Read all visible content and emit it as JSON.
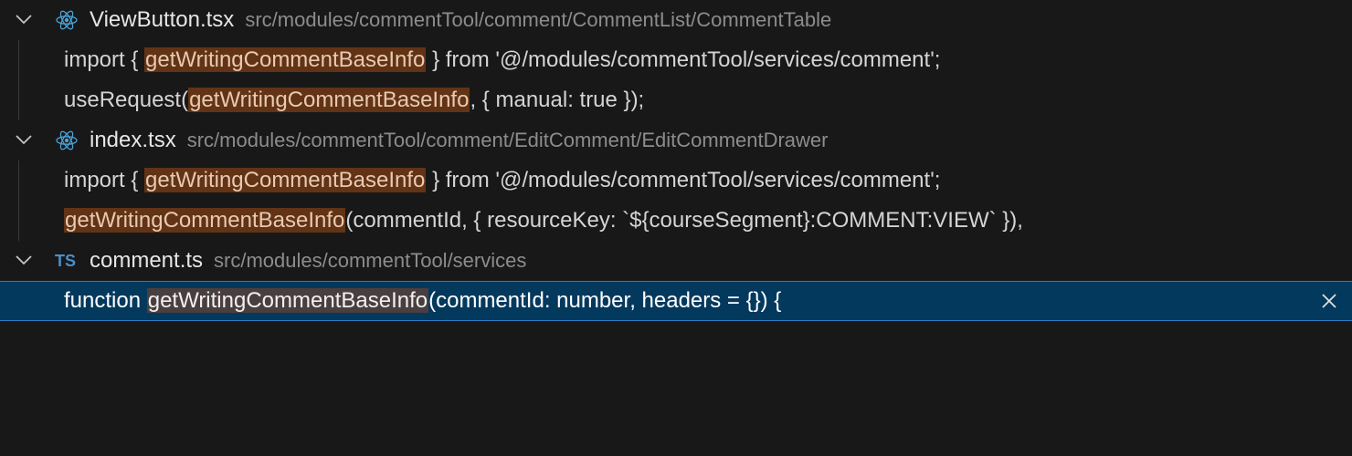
{
  "results": [
    {
      "file_name": "ViewButton.tsx",
      "path": "src/modules/commentTool/comment/CommentList/CommentTable",
      "icon": "react-icon",
      "matches": [
        {
          "before": "import { ",
          "match": "getWritingCommentBaseInfo",
          "after": " } from '@/modules/commentTool/services/comment';"
        },
        {
          "before": "useRequest(",
          "match": "getWritingCommentBaseInfo",
          "after": ", { manual: true });"
        }
      ]
    },
    {
      "file_name": "index.tsx",
      "path": "src/modules/commentTool/comment/EditComment/EditCommentDrawer",
      "icon": "react-icon",
      "matches": [
        {
          "before": "import { ",
          "match": "getWritingCommentBaseInfo",
          "after": " } from '@/modules/commentTool/services/comment';"
        },
        {
          "before": "",
          "match": "getWritingCommentBaseInfo",
          "after": "(commentId, { resourceKey: `${courseSegment}:COMMENT:VIEW` }),"
        }
      ]
    },
    {
      "file_name": "comment.ts",
      "path": "src/modules/commentTool/services",
      "icon": "typescript-icon",
      "icon_label": "TS",
      "matches": [
        {
          "before": "function ",
          "match": "getWritingCommentBaseInfo",
          "after": "(commentId: number, headers = {}) {"
        }
      ]
    }
  ],
  "colors": {
    "background": "#181818",
    "match_highlight": "#623315",
    "selected_row": "#04395e",
    "selected_border": "#2b7bc0",
    "react_icon": "#4aa3d8",
    "ts_icon": "#4d8fc7"
  }
}
